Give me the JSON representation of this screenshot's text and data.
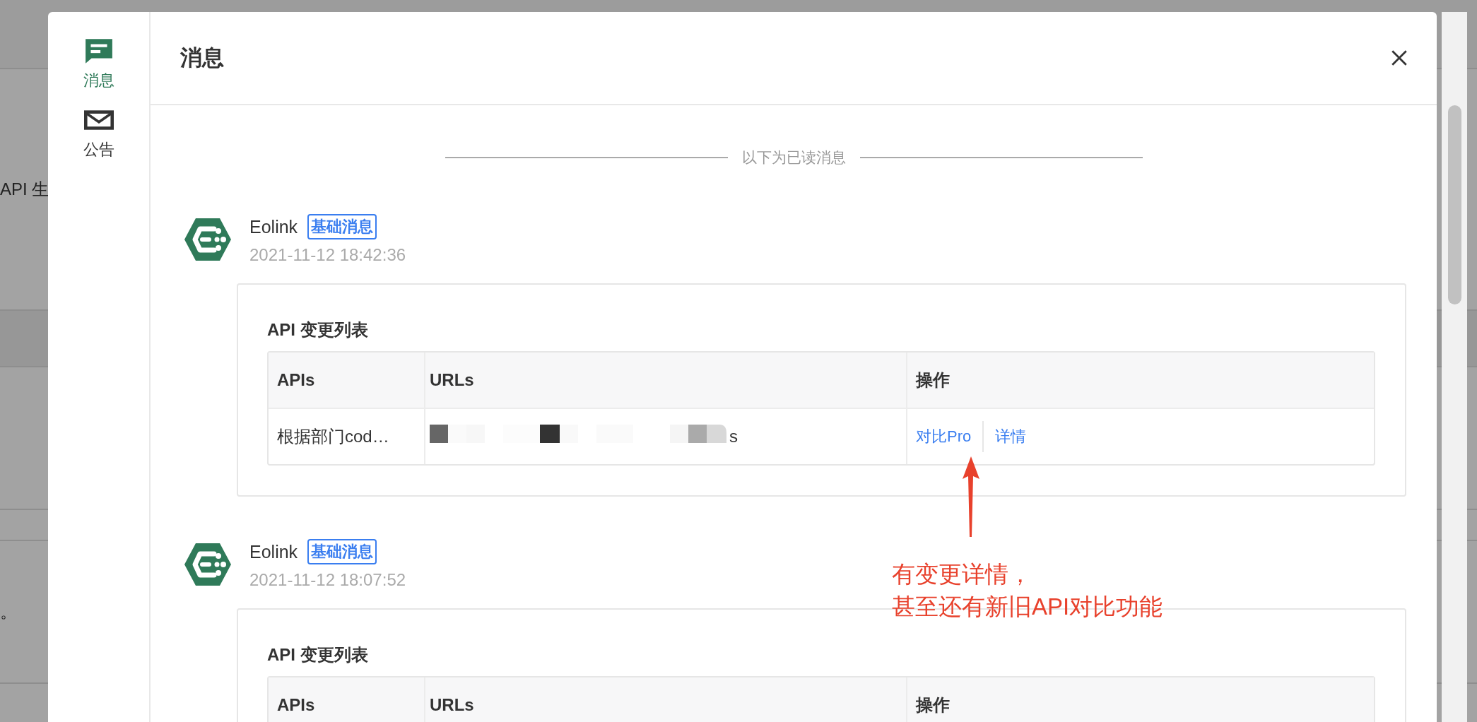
{
  "background": {
    "texts": [
      "API 生",
      "。"
    ]
  },
  "sidebar": {
    "items": [
      {
        "label": "消息",
        "kind": "message",
        "selected": true
      },
      {
        "label": "公告",
        "kind": "mail",
        "selected": false
      }
    ]
  },
  "dialog": {
    "title": "消息",
    "divider_label": "以下为已读消息",
    "messages": [
      {
        "sender": "Eolink",
        "tag": "基础消息",
        "time": "2021-11-12 18:42:36",
        "card": {
          "title": "API 变更列表",
          "columns": [
            "APIs",
            "URLs",
            "操作"
          ],
          "rows": [
            {
              "api": "根据部门cod…",
              "url_tail": "s",
              "actions": [
                "对比Pro",
                "详情"
              ]
            }
          ]
        }
      },
      {
        "sender": "Eolink",
        "tag": "基础消息",
        "time": "2021-11-12 18:07:52",
        "card": {
          "title": "API 变更列表",
          "columns": [
            "APIs",
            "URLs",
            "操作"
          ]
        }
      }
    ]
  },
  "annotation": {
    "lines": [
      "有变更详情，",
      "甚至还有新旧API对比功能"
    ]
  }
}
